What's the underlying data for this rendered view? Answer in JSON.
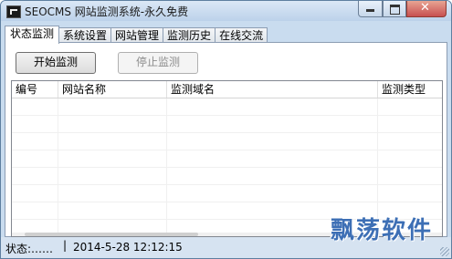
{
  "window": {
    "title": "SEOCMS 网站监测系统-永久免费",
    "controls": {
      "minimize": "minimize",
      "maximize": "maximize",
      "close": "✕"
    }
  },
  "tabs": [
    {
      "label": "状态监测",
      "active": true
    },
    {
      "label": "系统设置",
      "active": false
    },
    {
      "label": "网站管理",
      "active": false
    },
    {
      "label": "监测历史",
      "active": false
    },
    {
      "label": "在线交流",
      "active": false
    }
  ],
  "buttons": {
    "start_label": "开始监测",
    "stop_label": "停止监测"
  },
  "table": {
    "columns": [
      "编号",
      "网站名称",
      "监测域名",
      "监测类型"
    ],
    "rows": []
  },
  "status": {
    "text": "状态:……",
    "separator": "|",
    "time": "2014-5-28 12:12:15"
  },
  "watermark": "飘荡软件",
  "colors": {
    "frame": "#c9dcef",
    "watermark": "#3d6fb5",
    "close_button": "#c75050"
  }
}
